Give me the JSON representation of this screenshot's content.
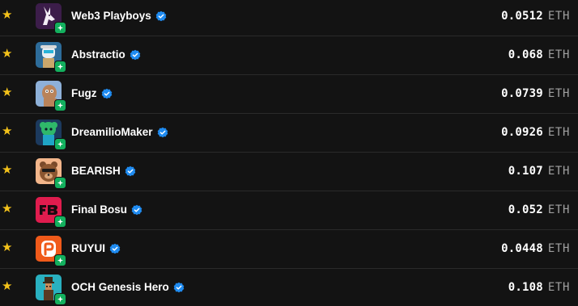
{
  "colors": {
    "background": "#131313",
    "star": "#f4c21a",
    "verified": "#1f8bf0",
    "chain_badge": "#13b05e",
    "divider": "#2a2a2a"
  },
  "collections": [
    {
      "name": "Web3 Playboys",
      "price": "0.0512",
      "unit": "ETH",
      "icon": "web3-playboys-avatar-icon",
      "avatar_bg": "#3c1d4a",
      "verified": true,
      "favorited": true
    },
    {
      "name": "Abstractio",
      "price": "0.068",
      "unit": "ETH",
      "icon": "abstractio-avatar-icon",
      "avatar_bg": "#2d6c9a",
      "verified": true,
      "favorited": true
    },
    {
      "name": "Fugz",
      "price": "0.0739",
      "unit": "ETH",
      "icon": "fugz-avatar-icon",
      "avatar_bg": "#8eb0d8",
      "verified": true,
      "favorited": true
    },
    {
      "name": "DreamilioMaker",
      "price": "0.0926",
      "unit": "ETH",
      "icon": "dreamiliomaker-avatar-icon",
      "avatar_bg": "#1c3a5e",
      "verified": true,
      "favorited": true
    },
    {
      "name": "BEARISH",
      "price": "0.107",
      "unit": "ETH",
      "icon": "bearish-avatar-icon",
      "avatar_bg": "#f2b58a",
      "verified": true,
      "favorited": true
    },
    {
      "name": "Final Bosu",
      "price": "0.052",
      "unit": "ETH",
      "icon": "final-bosu-avatar-icon",
      "avatar_bg": "#e01c4e",
      "verified": true,
      "favorited": true
    },
    {
      "name": "RUYUI",
      "price": "0.0448",
      "unit": "ETH",
      "icon": "ruyui-avatar-icon",
      "avatar_bg": "#f05a1a",
      "verified": true,
      "favorited": true
    },
    {
      "name": "OCH Genesis Hero",
      "price": "0.108",
      "unit": "ETH",
      "icon": "och-genesis-hero-avatar-icon",
      "avatar_bg": "#29b0c0",
      "verified": true,
      "favorited": true
    }
  ]
}
